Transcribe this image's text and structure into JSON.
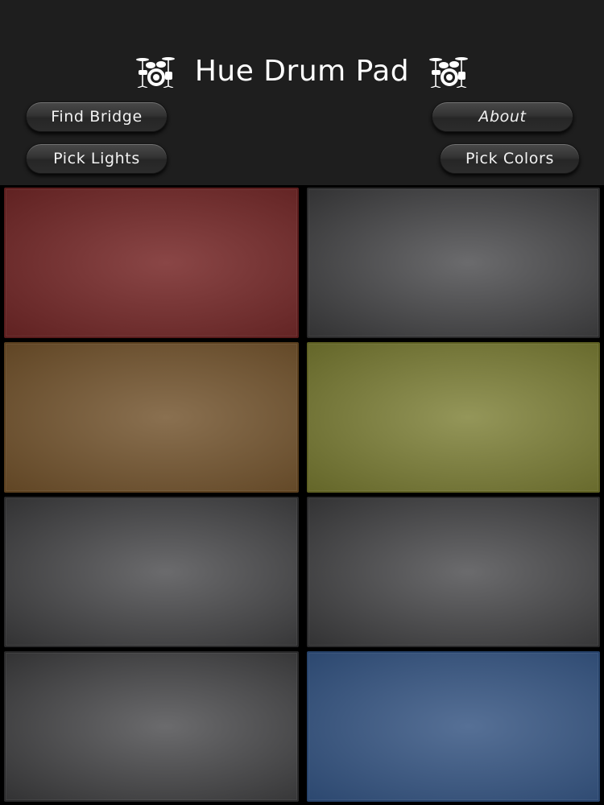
{
  "header": {
    "title": "Hue Drum Pad",
    "icons": [
      "drum-kit-icon",
      "drum-kit-icon"
    ]
  },
  "buttons": {
    "find_bridge": "Find Bridge",
    "about": "About",
    "pick_lights": "Pick Lights",
    "pick_colors": "Pick Colors"
  },
  "pads": [
    {
      "id": "pad-1",
      "color": "#8a4646",
      "edge": "#5a1c1c"
    },
    {
      "id": "pad-2",
      "color": "#6b6b6d",
      "edge": "#2a2a2b"
    },
    {
      "id": "pad-3",
      "color": "#8a7050",
      "edge": "#5a3f1e"
    },
    {
      "id": "pad-4",
      "color": "#949659",
      "edge": "#5d5f22"
    },
    {
      "id": "pad-5",
      "color": "#6b6b6d",
      "edge": "#2a2a2b"
    },
    {
      "id": "pad-6",
      "color": "#6b6b6d",
      "edge": "#2a2a2b"
    },
    {
      "id": "pad-7",
      "color": "#6b6b6d",
      "edge": "#2a2a2b"
    },
    {
      "id": "pad-8",
      "color": "#567096",
      "edge": "#26426a"
    }
  ]
}
